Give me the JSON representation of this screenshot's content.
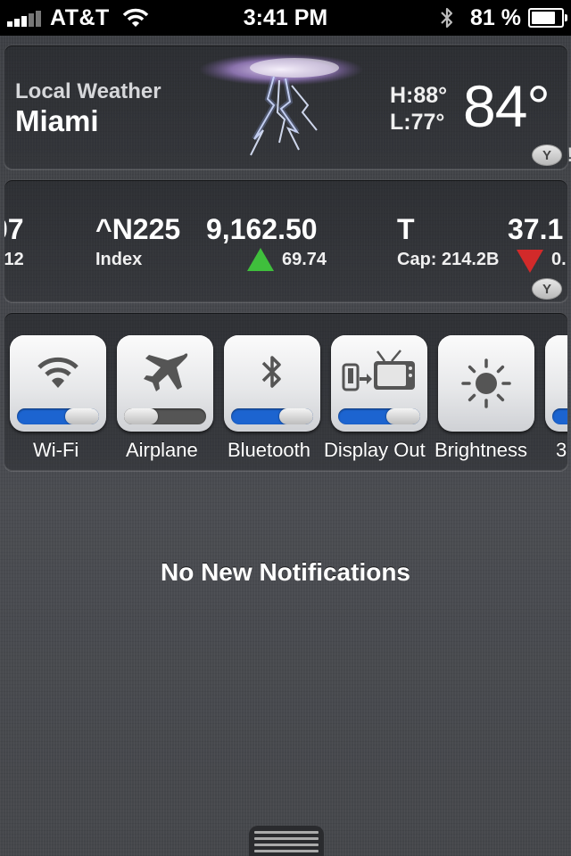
{
  "status_bar": {
    "carrier": "AT&T",
    "time": "3:41 PM",
    "battery_percent": "81 %",
    "battery_level": 0.81,
    "icons": [
      "signal-bars-icon",
      "wifi-icon",
      "bluetooth-icon",
      "battery-icon"
    ]
  },
  "weather": {
    "label": "Local Weather",
    "city": "Miami",
    "high": "H:88°",
    "low": "L:77°",
    "temperature": "84°",
    "condition_icon": "thunderstorm-icon",
    "provider_badge": "Y"
  },
  "stocks": {
    "items": [
      {
        "symbol": "07",
        "price": "",
        "detail": ".12",
        "change": "",
        "direction": ""
      },
      {
        "symbol": "^N225",
        "price": "9,162.50",
        "detail": "Index",
        "change": "69.74",
        "direction": "up"
      },
      {
        "symbol": "T",
        "price": "37.1",
        "detail": "Cap: 214.2B",
        "change": "0.",
        "direction": "down"
      }
    ],
    "provider_badge": "Y"
  },
  "toggles": {
    "items": [
      {
        "label": "Wi-Fi",
        "icon": "wifi-icon",
        "state": "on"
      },
      {
        "label": "Airplane",
        "icon": "airplane-icon",
        "state": "off"
      },
      {
        "label": "Bluetooth",
        "icon": "bluetooth-icon",
        "state": "on"
      },
      {
        "label": "Display Out",
        "icon": "display-out-icon",
        "state": "on"
      },
      {
        "label": "Brightness",
        "icon": "brightness-icon",
        "state": ""
      },
      {
        "label": "3",
        "icon": "",
        "state": "on"
      }
    ]
  },
  "notifications": {
    "empty_text": "No New Notifications"
  },
  "colors": {
    "toggle_on": "#1c64d0",
    "stock_up": "#3fbf3c",
    "stock_down": "#d22a2a"
  }
}
